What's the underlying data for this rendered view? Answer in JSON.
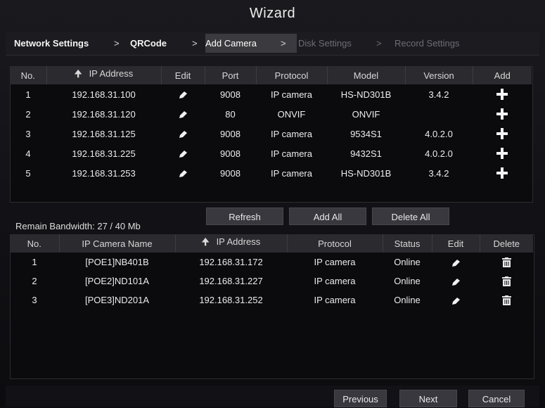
{
  "window": {
    "title": "Wizard"
  },
  "wizard_steps": [
    {
      "label": "Network Settings",
      "state": "done"
    },
    {
      "label": "QRCode",
      "state": "done"
    },
    {
      "label": "Add Camera",
      "state": "active"
    },
    {
      "label": "Disk Settings",
      "state": "todo"
    },
    {
      "label": "Record Settings",
      "state": "todo"
    }
  ],
  "step_separator": ">",
  "search_table": {
    "headers": {
      "no": "No.",
      "ip": "IP Address",
      "edit": "Edit",
      "port": "Port",
      "protocol": "Protocol",
      "model": "Model",
      "version": "Version",
      "add": "Add"
    },
    "sort_icon": "up-arrow-icon",
    "rows": [
      {
        "no": "1",
        "ip": "192.168.31.100",
        "port": "9008",
        "protocol": "IP camera",
        "model": "HS-ND301B",
        "version": "3.4.2"
      },
      {
        "no": "2",
        "ip": "192.168.31.120",
        "port": "80",
        "protocol": "ONVIF",
        "model": "ONVIF",
        "version": ""
      },
      {
        "no": "3",
        "ip": "192.168.31.125",
        "port": "9008",
        "protocol": "IP camera",
        "model": "9534S1",
        "version": "4.0.2.0"
      },
      {
        "no": "4",
        "ip": "192.168.31.225",
        "port": "9008",
        "protocol": "IP camera",
        "model": "9432S1",
        "version": "4.0.2.0"
      },
      {
        "no": "5",
        "ip": "192.168.31.253",
        "port": "9008",
        "protocol": "IP camera",
        "model": "HS-ND301B",
        "version": "3.4.2"
      }
    ]
  },
  "bandwidth": "Remain Bandwidth: 27 / 40 Mb",
  "actions": {
    "refresh": "Refresh",
    "add_all": "Add All",
    "delete_all": "Delete All"
  },
  "added_table": {
    "headers": {
      "no": "No.",
      "name": "IP Camera Name",
      "ip": "IP Address",
      "protocol": "Protocol",
      "status": "Status",
      "edit": "Edit",
      "delete": "Delete"
    },
    "rows": [
      {
        "no": "1",
        "name": "[POE1]NB401B",
        "ip": "192.168.31.172",
        "protocol": "IP camera",
        "status": "Online"
      },
      {
        "no": "2",
        "name": "[POE2]ND101A",
        "ip": "192.168.31.227",
        "protocol": "IP camera",
        "status": "Online"
      },
      {
        "no": "3",
        "name": "[POE3]ND201A",
        "ip": "192.168.31.252",
        "protocol": "IP camera",
        "status": "Online"
      }
    ]
  },
  "footer": {
    "previous": "Previous",
    "next": "Next",
    "cancel": "Cancel"
  },
  "colors": {
    "background": "#111115",
    "header_row": "#2a2a2f",
    "button": "#38383e",
    "text": "#ececec",
    "dim_text": "#6d6d73"
  }
}
